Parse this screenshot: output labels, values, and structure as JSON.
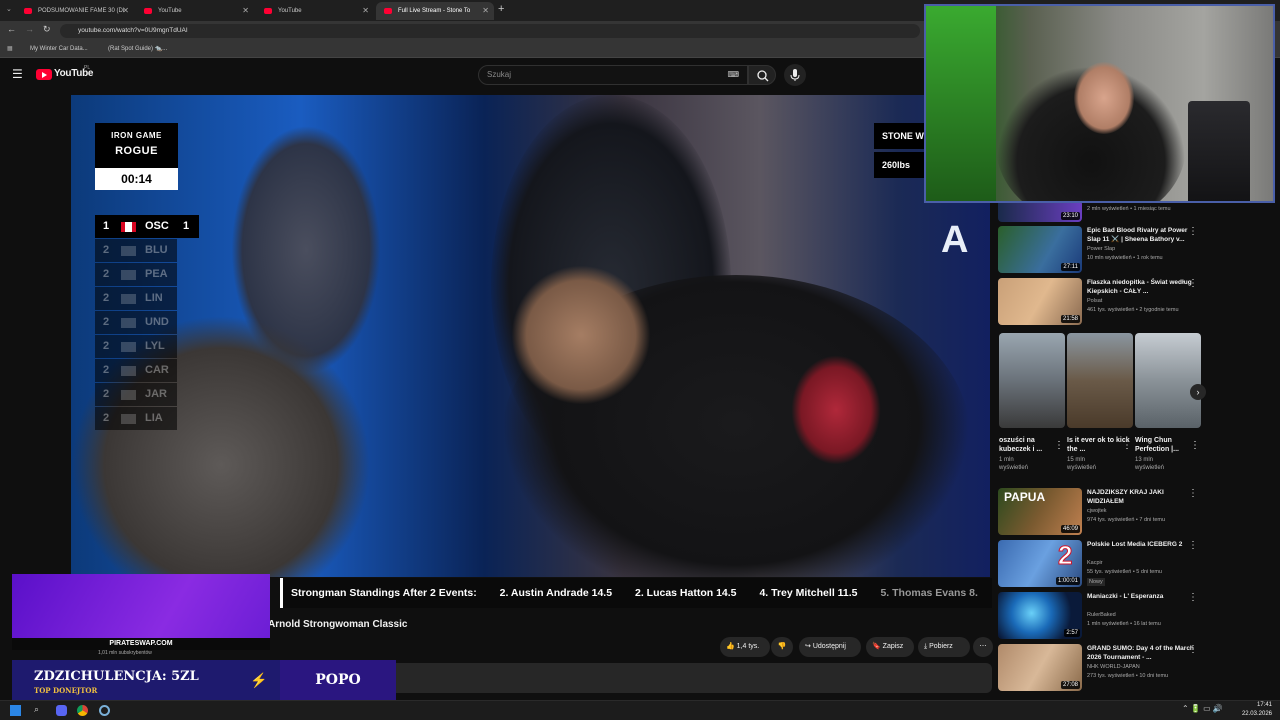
{
  "browser": {
    "tabs": [
      {
        "label": "PODSUMOWANIE FAME 30 (Di"
      },
      {
        "label": "YouTube"
      },
      {
        "label": "YouTube"
      },
      {
        "label": "Full Live Stream - Stone To"
      }
    ],
    "url": "youtube.com/watch?v=0U9mgnTdUAI",
    "bookmarks": [
      {
        "label": "My Winter Car Data..."
      },
      {
        "label": "(Rat Spot Guide) 🐀..."
      }
    ]
  },
  "youtube": {
    "logo": "YouTube",
    "region": "PL",
    "search_placeholder": "Szukaj"
  },
  "video_overlay": {
    "sponsor_line1": "IRON GAME",
    "sponsor_line2": "ROGUE",
    "timer": "00:14",
    "event": "STONE W",
    "weight": "260lbs",
    "standings": [
      {
        "rank": "1",
        "code": "OSC",
        "score": "1",
        "active": true
      },
      {
        "rank": "2",
        "code": "BLU",
        "score": "",
        "active": false
      },
      {
        "rank": "2",
        "code": "PEA",
        "score": "",
        "active": false
      },
      {
        "rank": "2",
        "code": "LIN",
        "score": "",
        "active": false
      },
      {
        "rank": "2",
        "code": "UND",
        "score": "",
        "active": false
      },
      {
        "rank": "2",
        "code": "LYL",
        "score": "",
        "active": false
      },
      {
        "rank": "2",
        "code": "CAR",
        "score": "",
        "active": false
      },
      {
        "rank": "2",
        "code": "JAR",
        "score": "",
        "active": false
      },
      {
        "rank": "2",
        "code": "LIA",
        "score": "",
        "active": false
      }
    ],
    "corner_logo": "A"
  },
  "ticker": {
    "items": [
      "Strongman Standings After 2 Events:",
      "2. Austin Andrade  14.5",
      "2. Lucas Hatton  14.5",
      "4. Trey Mitchell  11.5",
      "5. Thomas Evans  8."
    ]
  },
  "video_title_partial": "Arnold Strongwoman Classic",
  "channel_subscribers": "1,01 mln subskrybentów",
  "actions": {
    "likes": "1,4 tys.",
    "share": "Udostępnij",
    "save": "Zapisz",
    "download": "Pobierz"
  },
  "sidebar": {
    "top_partial": {
      "duration": "23:10",
      "meta": "2 mln wyświetleń • 1 miesiąc temu"
    },
    "recommendations": [
      {
        "title": "Epic Bad Blood Rivalry at Power Slap 11 ⚔️ | Sheena Bathory v...",
        "channel": "Power Slap",
        "meta": "10 mln wyświetleń • 1 rok temu",
        "duration": "27:11",
        "badge": ""
      },
      {
        "title": "Flaszka niedopitka - Świat według Kiepskich - CAŁY ...",
        "channel": "Polsat",
        "meta": "461 tys. wyświetleń • 2 tygodnie temu",
        "duration": "21:58",
        "badge": ""
      }
    ],
    "shorts": [
      {
        "title": "oszuści na kubeczek i ...",
        "views": "1 mln",
        "views2": "wyświetleń"
      },
      {
        "title": "Is it ever ok to kick the ...",
        "views": "15 mln",
        "views2": "wyświetleń"
      },
      {
        "title": "Wing Chun Perfection |...",
        "views": "13 mln",
        "views2": "wyświetleń"
      }
    ],
    "recommendations2": [
      {
        "title": "NAJDZIKSZY KRAJ JAKI WIDZIAŁEM",
        "channel": "cjwojtek",
        "meta": "974 tys. wyświetleń • 7 dni temu",
        "duration": "46:09",
        "badge": "",
        "thumbtext": "PAPUA"
      },
      {
        "title": "Polskie Lost Media ICEBERG 2",
        "channel": "Kacpir",
        "meta": "55 tys. wyświetleń • 5 dni temu",
        "duration": "1:00:01",
        "badge": "Nowy",
        "thumbtext": "2"
      },
      {
        "title": "Maniaczki - L' Esperanza",
        "channel": "RulerBaked",
        "meta": "1 mln wyświetleń • 16 lat temu",
        "duration": "2:57",
        "badge": "",
        "thumbtext": ""
      },
      {
        "title": "GRAND SUMO: Day 4 of the March 2026 Tournament - ...",
        "channel": "NHK WORLD-JAPAN",
        "meta": "273 tys. wyświetleń • 10 dni temu",
        "duration": "27:08",
        "badge": "",
        "thumbtext": ""
      }
    ]
  },
  "stream_overlay": {
    "promo_site": "PIRATESWAP.COM",
    "donation": "ZDZICHULENCJA: 5ZL",
    "donation_sub": "TOP DONEJTOR",
    "donor_name": "POPO"
  },
  "taskbar": {
    "time": "17:41",
    "date": "22.03.2026"
  },
  "colors": {
    "yt_red": "#ff0033",
    "bg": "#0f0f0f",
    "purple": "#7a1fe0"
  }
}
